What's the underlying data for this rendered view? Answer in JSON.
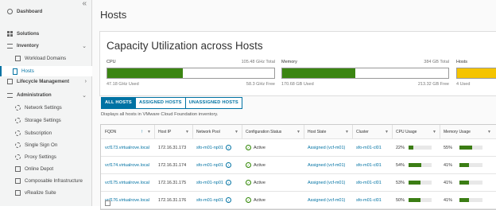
{
  "sidebar": {
    "collapse_label": "«",
    "items": [
      {
        "label": "Dashboard",
        "icon": "dashboard-icon",
        "level": 0
      },
      {
        "label": "Solutions",
        "icon": "solutions-icon",
        "level": 0
      },
      {
        "label": "Inventory",
        "icon": "inventory-icon",
        "level": 0,
        "expanded": true
      },
      {
        "label": "Workload Domains",
        "icon": "workload-domains-icon",
        "level": 1
      },
      {
        "label": "Hosts",
        "icon": "hosts-icon",
        "level": 1,
        "active": true
      },
      {
        "label": "Lifecycle Management",
        "icon": "lifecycle-icon",
        "level": 0,
        "expanded": false
      },
      {
        "label": "Administration",
        "icon": "administration-icon",
        "level": 0,
        "expanded": true
      },
      {
        "label": "Network Settings",
        "icon": "network-settings-icon",
        "level": 1
      },
      {
        "label": "Storage Settings",
        "icon": "storage-settings-icon",
        "level": 1
      },
      {
        "label": "Subscription",
        "icon": "subscription-icon",
        "level": 1
      },
      {
        "label": "Single Sign On",
        "icon": "sso-icon",
        "level": 1
      },
      {
        "label": "Proxy Settings",
        "icon": "proxy-settings-icon",
        "level": 1
      },
      {
        "label": "Online Depot",
        "icon": "online-depot-icon",
        "level": 1
      },
      {
        "label": "Composable Infrastructure",
        "icon": "composable-icon",
        "level": 1
      },
      {
        "label": "vRealize Suite",
        "icon": "vrealize-icon",
        "level": 1
      }
    ]
  },
  "page": {
    "title": "Hosts",
    "capacity_title": "Capacity Utilization across Hosts",
    "description": "Displays all hosts in VMware Cloud Foundation inventory."
  },
  "capacity": {
    "cpu": {
      "label": "CPU",
      "total": "105.48 GHz Total",
      "used": "47.18 GHz Used",
      "free": "58.3 GHz Free",
      "used_fraction": 0.45,
      "color": "#3b8512"
    },
    "memory": {
      "label": "Memory",
      "total": "384 GB Total",
      "used": "170.68 GB Used",
      "free": "213.32 GB Free",
      "used_fraction": 0.44,
      "color": "#3b8512"
    },
    "hosts": {
      "label": "Hosts",
      "used": "4 Used",
      "used_fraction": 1.0,
      "color": "#f5c400"
    }
  },
  "tabs": [
    "ALL HOSTS",
    "ASSIGNED HOSTS",
    "UNASSIGNED HOSTS"
  ],
  "table": {
    "columns": [
      "FQDN",
      "Host IP",
      "Network Pool",
      "Configuration Status",
      "Host State",
      "Cluster",
      "CPU Usage",
      "Memory Usage"
    ],
    "rows": [
      {
        "fqdn": "vcf173.virtualrove.local",
        "ip": "172.16.31.173",
        "pool": "sfo-m01-np01",
        "status": "Active",
        "state": "Assigned (vcf-m01)",
        "cluster": "sfo-m01-cl01",
        "cpu": "22%",
        "cpu_value": 22,
        "mem": "55%",
        "mem_value": 55
      },
      {
        "fqdn": "vcf174.virtualrove.local",
        "ip": "172.16.31.174",
        "pool": "sfo-m01-np01",
        "status": "Active",
        "state": "Assigned (vcf-m01)",
        "cluster": "sfo-m01-cl01",
        "cpu": "54%",
        "cpu_value": 54,
        "mem": "41%",
        "mem_value": 41
      },
      {
        "fqdn": "vcf175.virtualrove.local",
        "ip": "172.16.31.175",
        "pool": "sfo-m01-np01",
        "status": "Active",
        "state": "Assigned (vcf-m01)",
        "cluster": "sfo-m01-cl01",
        "cpu": "53%",
        "cpu_value": 53,
        "mem": "41%",
        "mem_value": 41
      },
      {
        "fqdn": "vcf176.virtualrove.local",
        "ip": "172.16.31.176",
        "pool": "sfo-m01-np01",
        "status": "Active",
        "state": "Assigned (vcf-m01)",
        "cluster": "sfo-m01-cl01",
        "cpu": "50%",
        "cpu_value": 50,
        "mem": "41%",
        "mem_value": 41
      }
    ]
  },
  "colors": {
    "accent": "#0072a3",
    "success": "#2e8500",
    "usage_bar": "#3b7d14"
  }
}
